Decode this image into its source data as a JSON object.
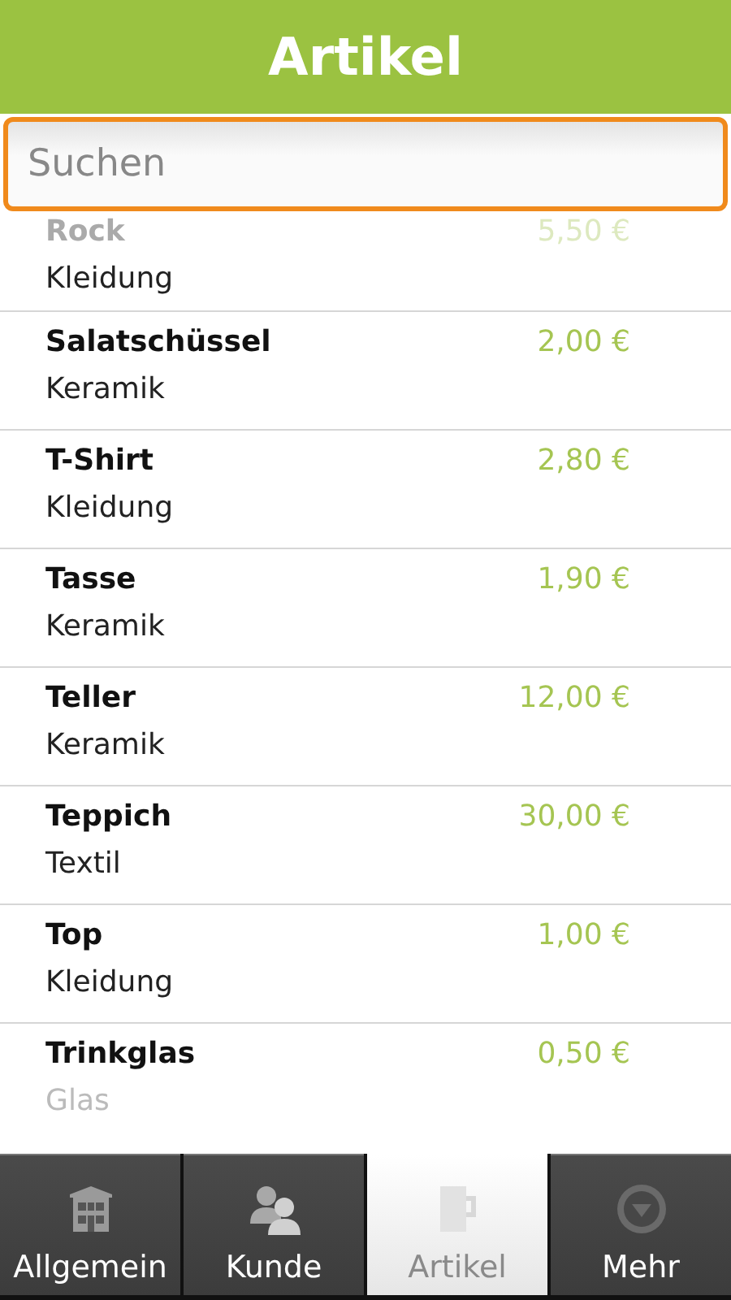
{
  "header": {
    "title": "Artikel"
  },
  "search": {
    "placeholder": "Suchen"
  },
  "articles": [
    {
      "name": "Rock",
      "category": "Kleidung",
      "price": "5,50 €"
    },
    {
      "name": "Salatschüssel",
      "category": "Keramik",
      "price": "2,00 €"
    },
    {
      "name": "T-Shirt",
      "category": "Kleidung",
      "price": "2,80 €"
    },
    {
      "name": "Tasse",
      "category": "Keramik",
      "price": "1,90 €"
    },
    {
      "name": "Teller",
      "category": "Keramik",
      "price": "12,00 €"
    },
    {
      "name": "Teppich",
      "category": "Textil",
      "price": "30,00 €"
    },
    {
      "name": "Top",
      "category": "Kleidung",
      "price": "1,00 €"
    },
    {
      "name": "Trinkglas",
      "category": "Glas",
      "price": "0,50 €"
    }
  ],
  "tabs": [
    {
      "label": "Allgemein",
      "kind": "building",
      "selected": false
    },
    {
      "label": "Kunde",
      "kind": "people",
      "selected": false
    },
    {
      "label": "Artikel",
      "kind": "mug",
      "selected": true
    },
    {
      "label": "Mehr",
      "kind": "more",
      "selected": false
    }
  ]
}
